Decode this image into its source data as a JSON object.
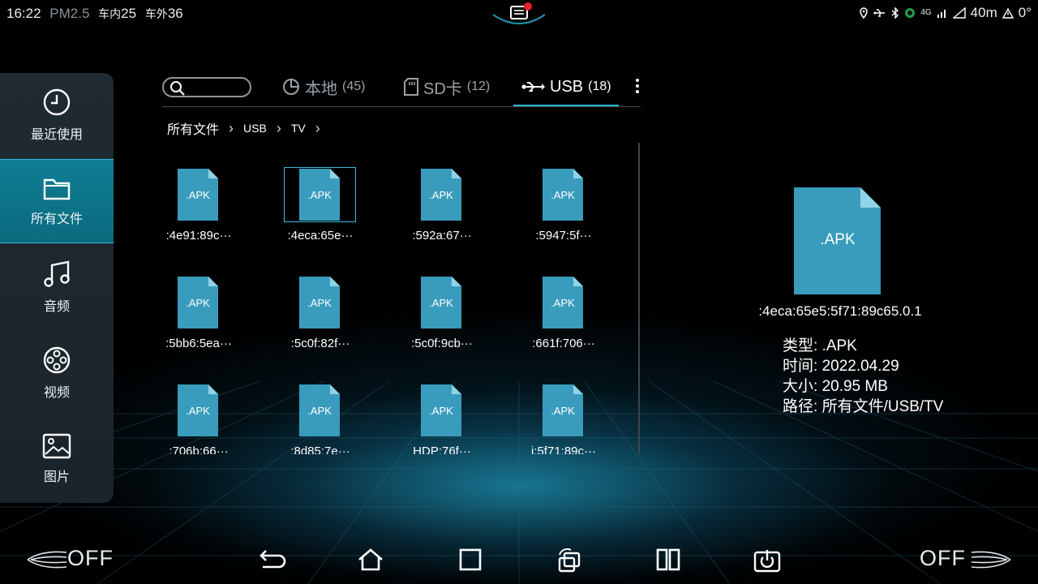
{
  "status_bar": {
    "time": "16:22",
    "pm_label": "PM2.5",
    "inside_label": "车内",
    "inside_value": "25",
    "outside_label": "车外",
    "outside_value": "36",
    "right_text": "40m",
    "right_extra": "0°",
    "network_label": "4G",
    "icons": [
      "location-icon",
      "usb-icon",
      "bluetooth-icon",
      "android-icon",
      "signal-icon",
      "wifi-icon",
      "alert-icon"
    ]
  },
  "sidebar": {
    "items": [
      {
        "label": "最近使用",
        "icon": "clock-icon"
      },
      {
        "label": "所有文件",
        "icon": "folder-icon",
        "active": true
      },
      {
        "label": "音频",
        "icon": "music-icon"
      },
      {
        "label": "视频",
        "icon": "film-reel-icon"
      },
      {
        "label": "图片",
        "icon": "image-icon"
      }
    ]
  },
  "tabs": [
    {
      "label": "本地",
      "count": "(45)",
      "icon": "pie-icon"
    },
    {
      "label": "SD卡",
      "count": "(12)",
      "icon": "sd-card-icon"
    },
    {
      "label": "USB",
      "count": "(18)",
      "icon": "usb-icon",
      "active": true
    }
  ],
  "breadcrumb": [
    "所有文件",
    "USB",
    "TV"
  ],
  "file_type_label": ".APK",
  "files": [
    {
      "name": ":4e91:89c···"
    },
    {
      "name": ":4eca:65e···",
      "selected": true
    },
    {
      "name": ":592a:67···"
    },
    {
      "name": ":5947:5f···"
    },
    {
      "name": ":5bb6:5ea···"
    },
    {
      "name": ":5c0f:82f···"
    },
    {
      "name": ":5c0f:9cb···"
    },
    {
      "name": ":661f:706···"
    },
    {
      "name": ":706b:66···"
    },
    {
      "name": ":8d85:7e···"
    },
    {
      "name": "HDP:76f···"
    },
    {
      "name": "i:5f71:89c···"
    }
  ],
  "detail": {
    "icon_label": ".APK",
    "name": ":4eca:65e5:5f71:89c65.0.1",
    "type_label": "类型:",
    "type_value": ".APK",
    "time_label": "时间:",
    "time_value": "2022.04.29",
    "size_label": "大小:",
    "size_value": "20.95 MB",
    "path_label": "路径:",
    "path_value": "所有文件/USB/TV"
  },
  "bottom": {
    "left_off": "OFF",
    "right_off": "OFF",
    "icons": [
      "back-icon",
      "home-icon",
      "recent-apps-icon",
      "rotate-screen-icon",
      "split-screen-icon",
      "power-icon"
    ]
  },
  "colors": {
    "accent": "#2bb6d3",
    "file_icon": "#3a9cbd",
    "sidebar_active": "#0f7e94"
  }
}
